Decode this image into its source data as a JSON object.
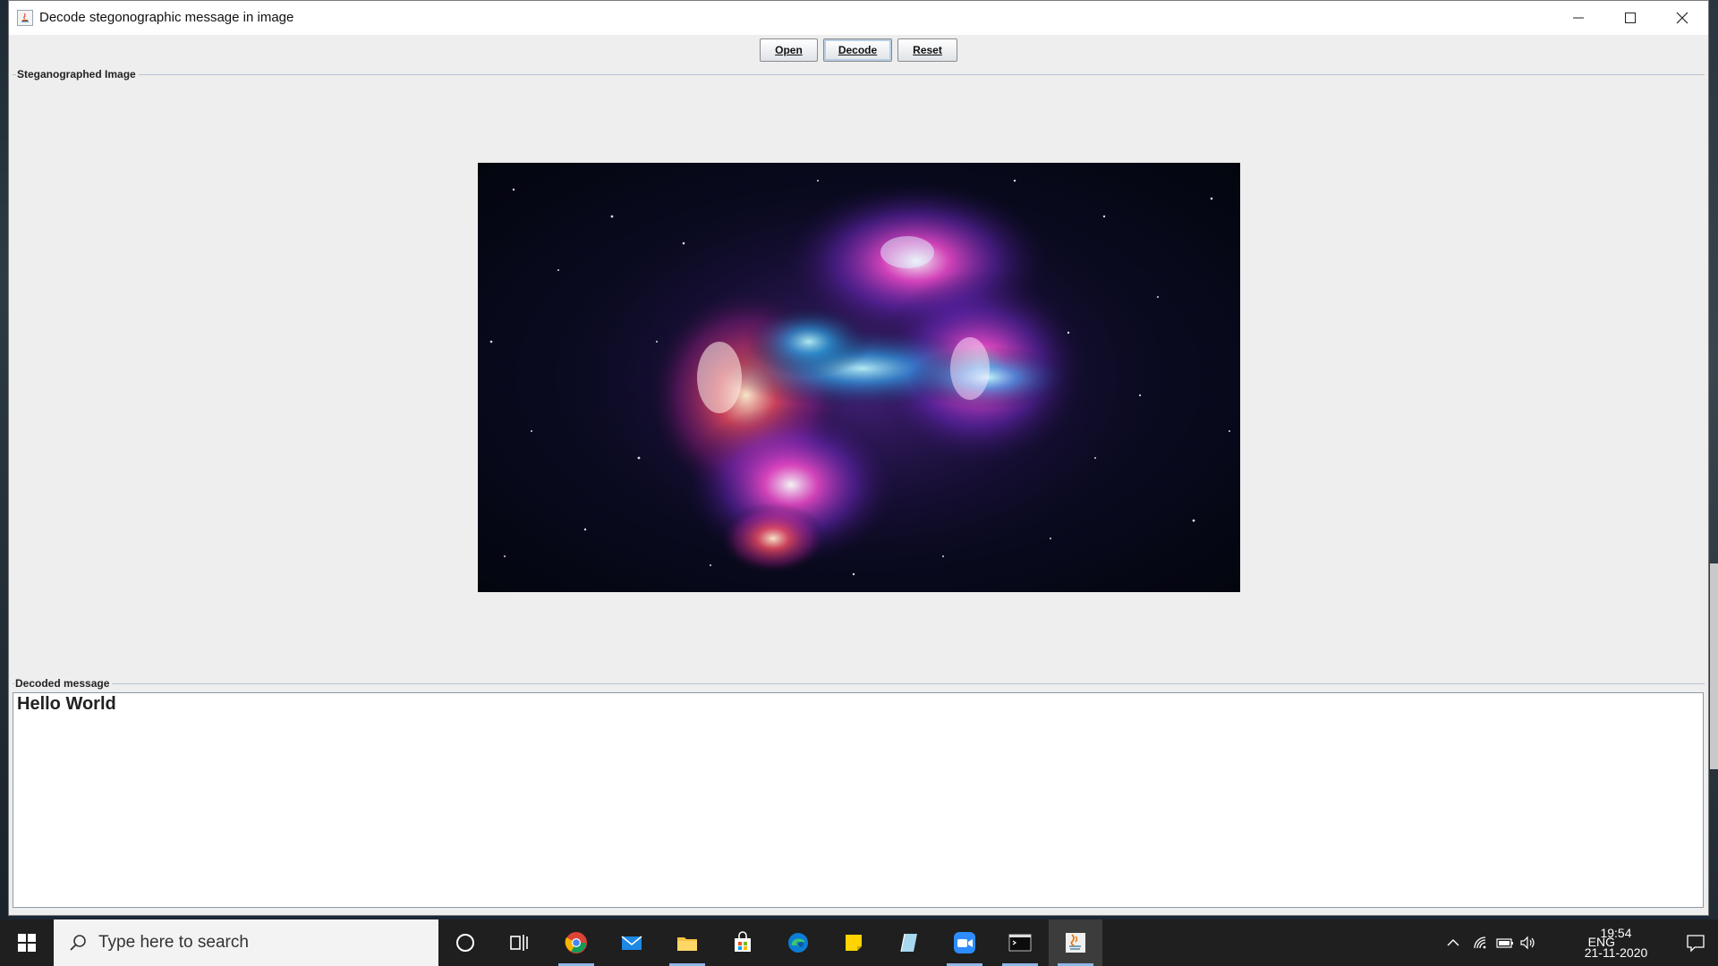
{
  "window": {
    "title": "Decode stegonographic message in image"
  },
  "toolbar": {
    "open_label": "Open",
    "decode_label": "Decode",
    "reset_label": "Reset"
  },
  "image_panel": {
    "title": "Steganographed Image"
  },
  "message_panel": {
    "title": "Decoded message",
    "text": "Hello World"
  },
  "taskbar": {
    "search_placeholder": "Type here to search",
    "pinned_icons": [
      "cortana-icon",
      "task-view-icon",
      "chrome-icon",
      "mail-icon",
      "file-explorer-icon",
      "store-icon",
      "edge-icon",
      "sticky-notes-icon",
      "notepad-icon",
      "zoom-icon",
      "terminal-icon",
      "java-icon"
    ],
    "tray": {
      "language": "ENG",
      "time": "19:54",
      "date": "21-11-2020"
    }
  },
  "colors": {
    "window_bg": "#eeeeee",
    "taskbar_bg": "#1f1f1f",
    "accent": "#8fb6e6"
  }
}
